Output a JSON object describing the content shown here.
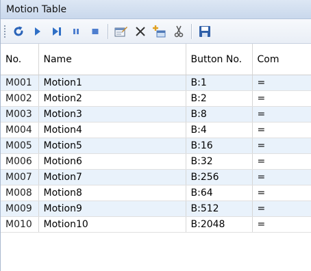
{
  "window": {
    "title": "Motion Table"
  },
  "toolbar": {
    "buttons": [
      {
        "icon": "refresh-icon",
        "color": "#2a63b8"
      },
      {
        "icon": "play-icon",
        "color": "#2f6fc6"
      },
      {
        "icon": "step-icon",
        "color": "#2f6fc6"
      },
      {
        "icon": "pause-icon",
        "color": "#4f7fcf"
      },
      {
        "icon": "stop-icon",
        "color": "#4f7fcf"
      },
      {
        "icon": "properties-icon"
      },
      {
        "icon": "delete-icon"
      },
      {
        "icon": "add-icon"
      },
      {
        "icon": "cut-icon"
      },
      {
        "icon": "save-icon"
      }
    ]
  },
  "table": {
    "headers": {
      "no": "No.",
      "name": "Name",
      "button": "Button No.",
      "com": "Com"
    },
    "rows": [
      {
        "no": "M001",
        "name": "Motion1",
        "button": "B:1",
        "com": "="
      },
      {
        "no": "M002",
        "name": "Motion2",
        "button": "B:2",
        "com": "="
      },
      {
        "no": "M003",
        "name": "Motion3",
        "button": "B:8",
        "com": "="
      },
      {
        "no": "M004",
        "name": "Motion4",
        "button": "B:4",
        "com": "="
      },
      {
        "no": "M005",
        "name": "Motion5",
        "button": "B:16",
        "com": "="
      },
      {
        "no": "M006",
        "name": "Motion6",
        "button": "B:32",
        "com": "="
      },
      {
        "no": "M007",
        "name": "Motion7",
        "button": "B:256",
        "com": "="
      },
      {
        "no": "M008",
        "name": "Motion8",
        "button": "B:64",
        "com": "="
      },
      {
        "no": "M009",
        "name": "Motion9",
        "button": "B:512",
        "com": "="
      },
      {
        "no": "M010",
        "name": "Motion10",
        "button": "B:2048",
        "com": "="
      }
    ]
  },
  "colors": {
    "row_alt": "#e9f2fb",
    "title_bar": "#c9d8ec"
  }
}
